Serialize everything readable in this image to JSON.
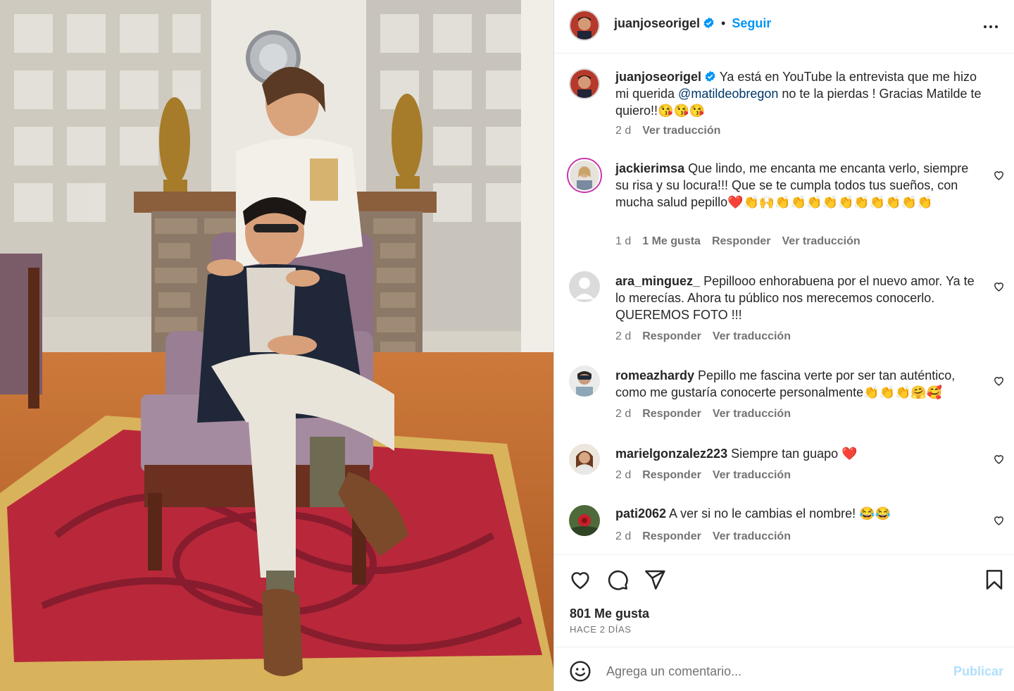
{
  "post": {
    "author": "juanjoseorigel",
    "follow_label": "Seguir",
    "dot": "•",
    "caption_author": "juanjoseorigel",
    "caption_pre": " Ya está en YouTube la entrevista que me hizo mi querida ",
    "caption_mention": "@matildeobregon",
    "caption_post": " no te la pierdas ! Gracias Matilde te quiero!!😘😘😘",
    "caption_time": "2 d",
    "caption_translate": "Ver traducción"
  },
  "comments": [
    {
      "user": "jackierimsa",
      "text": " Que lindo, me encanta me encanta verlo, siempre su risa y su locura!!! Que se te cumpla todos tus sueños, con mucha salud pepillo❤️👏🙌👏👏👏👏👏👏👏👏👏👏",
      "time": "1 d",
      "likes": "1 Me gusta",
      "reply": "Responder",
      "translate": "Ver traducción"
    },
    {
      "user": "ara_minguez_",
      "text": " Pepillooo enhorabuena por el nuevo amor. Ya te lo merecías. Ahora tu público nos merecemos conocerlo. QUEREMOS FOTO !!!",
      "time": "2 d",
      "reply": "Responder",
      "translate": "Ver traducción"
    },
    {
      "user": "romeazhardy",
      "text": " Pepillo me fascina verte por ser tan auténtico, como me gustaría conocerte personalmente👏👏👏🤗🥰",
      "time": "2 d",
      "reply": "Responder",
      "translate": "Ver traducción"
    },
    {
      "user": "marielgonzalez223",
      "text": " Siempre tan guapo ❤️",
      "time": "2 d",
      "reply": "Responder",
      "translate": "Ver traducción"
    },
    {
      "user": "pati2062",
      "text": " A ver si no le cambias el nombre! 😂😂",
      "time": "2 d",
      "reply": "Responder",
      "translate": "Ver traducción"
    }
  ],
  "actions": {
    "likes": "801 Me gusta",
    "date": "HACE 2 DÍAS"
  },
  "add_comment": {
    "placeholder": "Agrega un comentario...",
    "publish_label": "Publicar"
  },
  "colors": {
    "link": "#0095f6",
    "mention": "#00376b",
    "muted": "#737373",
    "verified": "#0095f6"
  }
}
